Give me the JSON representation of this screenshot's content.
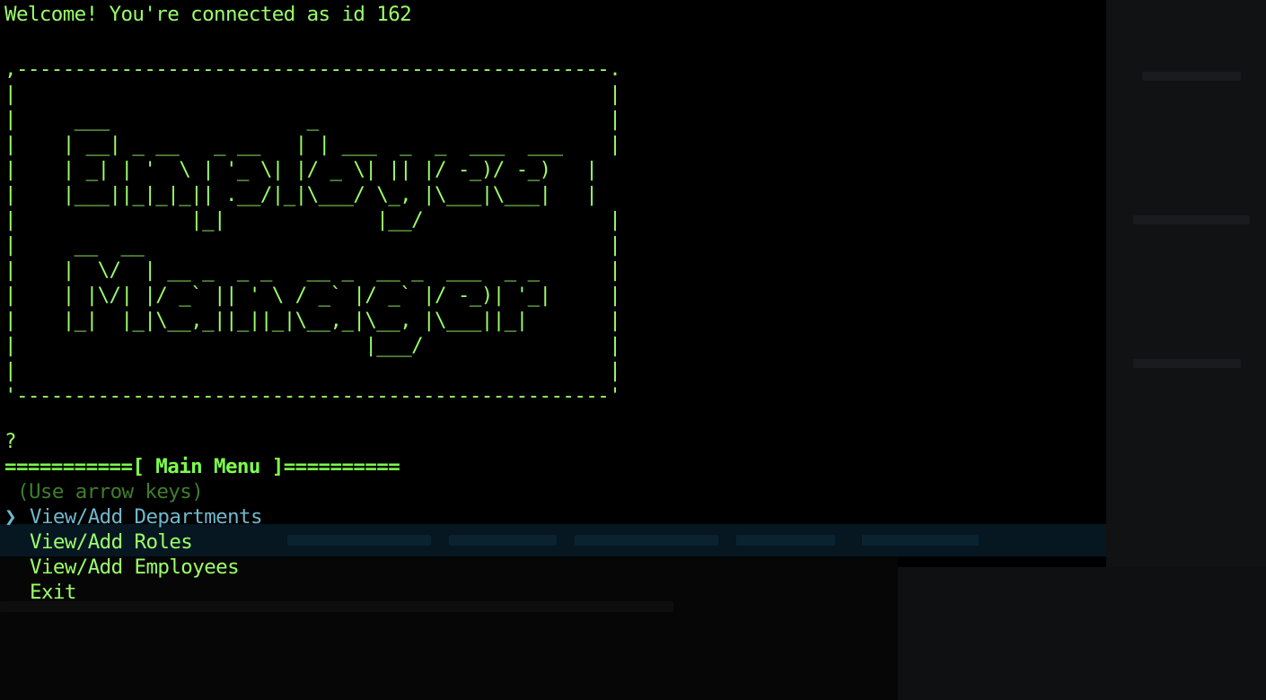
{
  "terminal": {
    "welcome": "Welcome! You're connected as id 162",
    "banner": [
      ",---------------------------------------------------.",
      "|                                                   |",
      "|     ___                 _                         |",
      "|    | __| _ __   _ __   | | ___  _  _  ___  ___    |",
      "|    | _| | '  \\ | '_ \\| |/ _ \\| || |/ -_)/ -_)   |",
      "|    |___||_|_|_|| .__/|_|\\___/ \\_, |\\___|\\___|   |",
      "|               |_|             |__/                |",
      "|     __  __                                        |",
      "|    |  \\/  | __ _  _ _   __ _  __ _  ___  _ _      |",
      "|    | |\\/| |/ _` || ' \\ / _` |/ _` |/ -_)| '_|     |",
      "|    |_|  |_|\\__,_||_||_|\\__,_|\\__, |\\___||_|       |",
      "|                              |___/                |",
      "|                                                   |",
      "'---------------------------------------------------'"
    ],
    "prompt_mark": "?",
    "menu_header": "===========[ Main Menu ]==========",
    "hint": "(Use arrow keys)",
    "pointer": "❯",
    "options": [
      "View/Add Departments",
      "View/Add Roles",
      "View/Add Employees",
      "Exit"
    ],
    "selected_index": 0
  },
  "colors": {
    "text": "#9bff6a",
    "selected": "#6fb8cf",
    "hint": "#3f7f2c",
    "background": "#000000"
  }
}
